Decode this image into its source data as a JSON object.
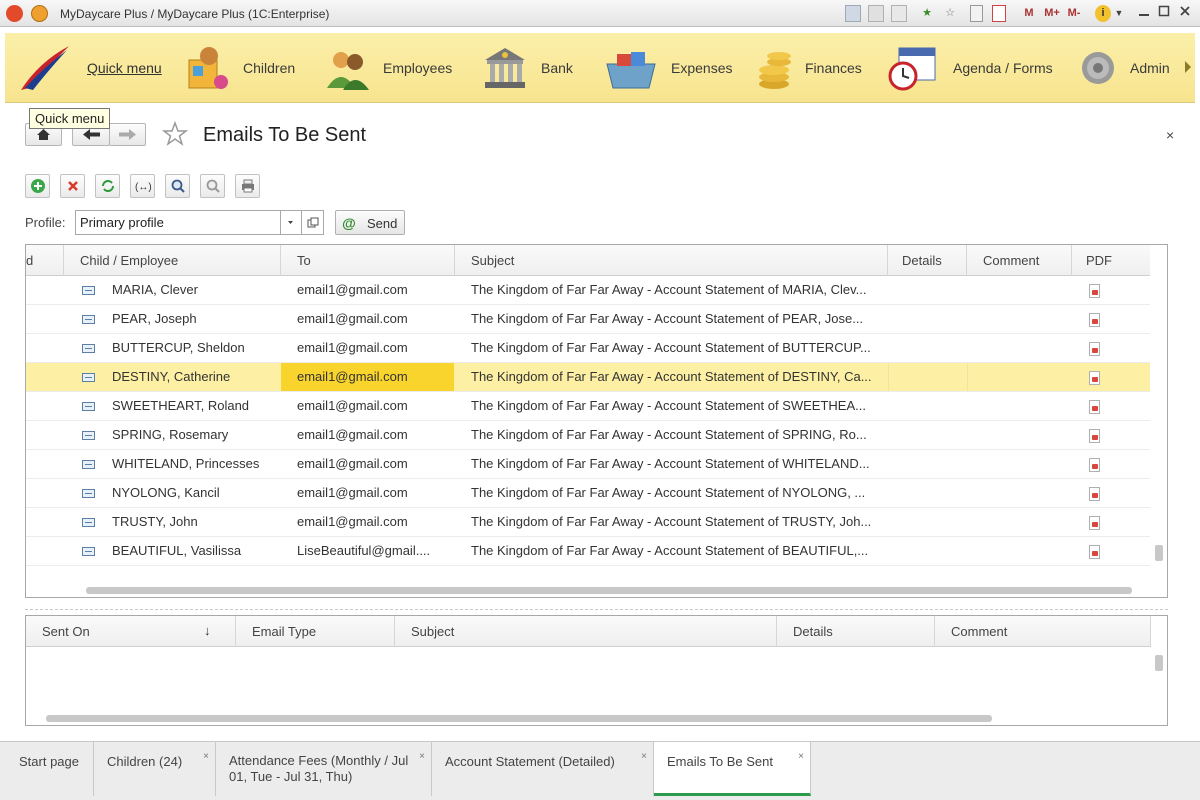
{
  "window": {
    "title": "MyDaycare Plus / MyDaycare Plus  (1C:Enterprise)",
    "controls": {
      "memory": "M",
      "memory_plus": "M+",
      "memory_minus": "M-",
      "info": "i"
    }
  },
  "sections": {
    "quick_menu": "Quick menu",
    "items": [
      {
        "label": "Children",
        "icon": "children-toys-icon"
      },
      {
        "label": "Employees",
        "icon": "employees-people-icon"
      },
      {
        "label": "Bank",
        "icon": "bank-building-icon"
      },
      {
        "label": "Expenses",
        "icon": "shopping-basket-icon"
      },
      {
        "label": "Finances",
        "icon": "coins-stack-icon"
      },
      {
        "label": "Agenda / Forms",
        "icon": "calendar-clock-icon"
      },
      {
        "label": "Admin",
        "icon": "gear-icon"
      }
    ]
  },
  "tooltip": "Quick menu",
  "form": {
    "title": "Emails To Be Sent",
    "close": "×"
  },
  "profile": {
    "label": "Profile:",
    "value": "Primary profile",
    "send_label": "Send"
  },
  "grid": {
    "columns": [
      "d",
      "Child / Employee",
      "To",
      "Subject",
      "Details",
      "Comment",
      "PDF"
    ],
    "rows": [
      {
        "name": "MARIA, Clever",
        "to": "email1@gmail.com",
        "subject": "The Kingdom of Far Far Away - Account Statement of MARIA, Clev..."
      },
      {
        "name": "PEAR, Joseph",
        "to": "email1@gmail.com",
        "subject": "The Kingdom of Far Far Away - Account Statement of PEAR, Jose..."
      },
      {
        "name": "BUTTERCUP, Sheldon",
        "to": "email1@gmail.com",
        "subject": "The Kingdom of Far Far Away - Account Statement of BUTTERCUP..."
      },
      {
        "name": "DESTINY, Catherine",
        "to": "email1@gmail.com",
        "subject": "The Kingdom of Far Far Away - Account Statement of DESTINY, Ca...",
        "selected": true
      },
      {
        "name": "SWEETHEART, Roland",
        "to": "email1@gmail.com",
        "subject": "The Kingdom of Far Far Away - Account Statement of SWEETHEA..."
      },
      {
        "name": "SPRING, Rosemary",
        "to": "email1@gmail.com",
        "subject": "The Kingdom of Far Far Away - Account Statement of SPRING, Ro..."
      },
      {
        "name": "WHITELAND, Princesses",
        "to": "email1@gmail.com",
        "subject": "The Kingdom of Far Far Away - Account Statement of WHITELAND..."
      },
      {
        "name": "NYOLONG, Kancil",
        "to": "email1@gmail.com",
        "subject": "The Kingdom of Far Far Away - Account Statement of NYOLONG, ..."
      },
      {
        "name": "TRUSTY, John",
        "to": "email1@gmail.com",
        "subject": "The Kingdom of Far Far Away - Account Statement of TRUSTY, Joh..."
      },
      {
        "name": "BEAUTIFUL, Vasilissa",
        "to": "LiseBeautiful@gmail....",
        "subject": "The Kingdom of Far Far Away - Account Statement of BEAUTIFUL,..."
      }
    ]
  },
  "sent_grid": {
    "columns": [
      "Sent On",
      "Email Type",
      "Subject",
      "Details",
      "Comment"
    ],
    "sort_indicator": "↓"
  },
  "tabs": [
    {
      "label": "Start page",
      "closable": false
    },
    {
      "label": "Children (24)",
      "closable": true
    },
    {
      "label": "Attendance Fees (Monthly / Jul 01, Tue - Jul 31, Thu)",
      "closable": true
    },
    {
      "label": "Account Statement (Detailed)",
      "closable": true
    },
    {
      "label": "Emails To Be Sent",
      "closable": true,
      "active": true
    }
  ],
  "colors": {
    "section_bg": "#f7e48f",
    "row_selected": "#fdf0a4",
    "cell_selected": "#f9d42c",
    "tab_active_underline": "#2e9a4d"
  }
}
